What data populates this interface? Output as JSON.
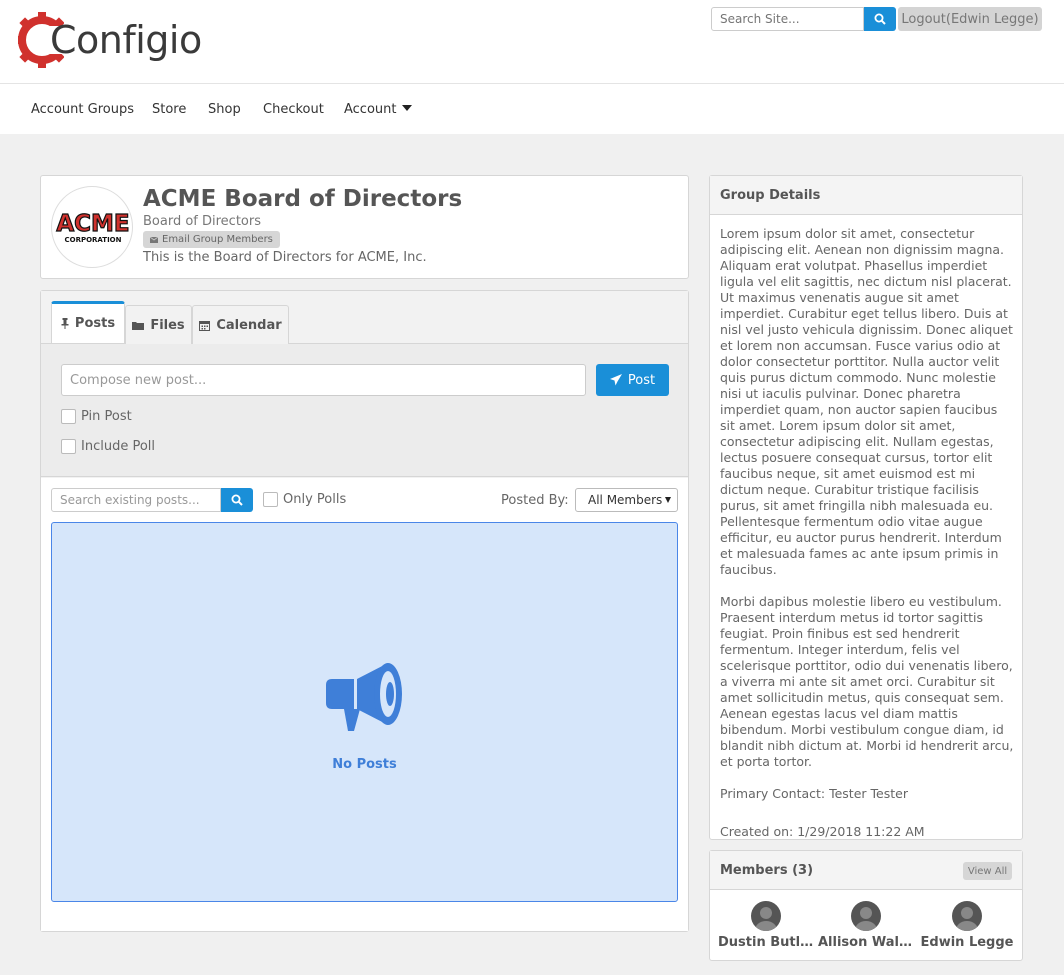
{
  "brand": {
    "name": "Configio"
  },
  "header": {
    "search_placeholder": "Search Site...",
    "logout_label": "Logout(Edwin Legge)"
  },
  "nav": {
    "items": [
      "Account Groups",
      "Store",
      "Shop",
      "Checkout",
      "Account"
    ]
  },
  "group": {
    "logo_top": "ACME",
    "logo_bottom": "CORPORATION",
    "title": "ACME Board of Directors",
    "subtitle": "Board of Directors",
    "email_label": "Email Group Members",
    "description": "This is the Board of Directors for ACME, Inc."
  },
  "tabs": [
    {
      "label": "Posts"
    },
    {
      "label": "Files"
    },
    {
      "label": "Calendar"
    }
  ],
  "compose": {
    "placeholder": "Compose new post...",
    "post_label": "Post",
    "pin_label": "Pin Post",
    "poll_label": "Include Poll"
  },
  "filters": {
    "search_placeholder": "Search existing posts...",
    "only_polls_label": "Only Polls",
    "posted_by_label": "Posted By:",
    "posted_by_value": "All Members"
  },
  "empty": {
    "text": "No Posts"
  },
  "details": {
    "title": "Group Details",
    "para1": "Lorem ipsum dolor sit amet, consectetur adipiscing elit. Aenean non dignissim magna. Aliquam erat volutpat. Phasellus imperdiet ligula vel elit sagittis, nec dictum nisl placerat. Ut maximus venenatis augue sit amet imperdiet. Curabitur eget tellus libero. Duis at nisl vel justo vehicula dignissim. Donec aliquet et lorem non accumsan. Fusce varius odio at dolor consectetur porttitor. Nulla auctor velit quis purus dictum commodo. Nunc molestie nisi ut iaculis pulvinar. Donec pharetra imperdiet quam, non auctor sapien faucibus sit amet. Lorem ipsum dolor sit amet, consectetur adipiscing elit. Nullam egestas, lectus posuere consequat cursus, tortor elit faucibus neque, sit amet euismod est mi dictum neque. Curabitur tristique facilisis purus, sit amet fringilla nibh malesuada eu. Pellentesque fermentum odio vitae augue efficitur, eu auctor purus hendrerit. Interdum et malesuada fames ac ante ipsum primis in faucibus.",
    "para2": "Morbi dapibus molestie libero eu vestibulum. Praesent interdum metus id tortor sagittis feugiat. Proin finibus est sed hendrerit fermentum. Integer interdum, felis vel scelerisque porttitor, odio dui venenatis libero, a viverra mi ante sit amet orci. Curabitur sit amet sollicitudin metus, quis consequat sem. Aenean egestas lacus vel diam mattis bibendum. Morbi vestibulum congue diam, id blandit nibh dictum at. Morbi id hendrerit arcu, et porta tortor.",
    "primary_contact": "Primary Contact: Tester Tester",
    "created": "Created on: 1/29/2018 11:22 AM"
  },
  "members": {
    "title": "Members (3)",
    "view_all": "View All",
    "list": [
      {
        "name": "Dustin Butler"
      },
      {
        "name": "Allison Walker"
      },
      {
        "name": "Edwin Legge"
      }
    ]
  },
  "colors": {
    "accent": "#1a8fd8",
    "empty_bg": "#d6e6fa",
    "empty_icon": "#3f7fd8",
    "logo_red": "#d0312d"
  },
  "icons": [
    "gear-logo-icon",
    "search-icon",
    "pin-icon",
    "folder-icon",
    "calendar-icon",
    "paper-plane-icon",
    "envelope-icon",
    "megaphone-icon",
    "user-avatar-icon"
  ]
}
